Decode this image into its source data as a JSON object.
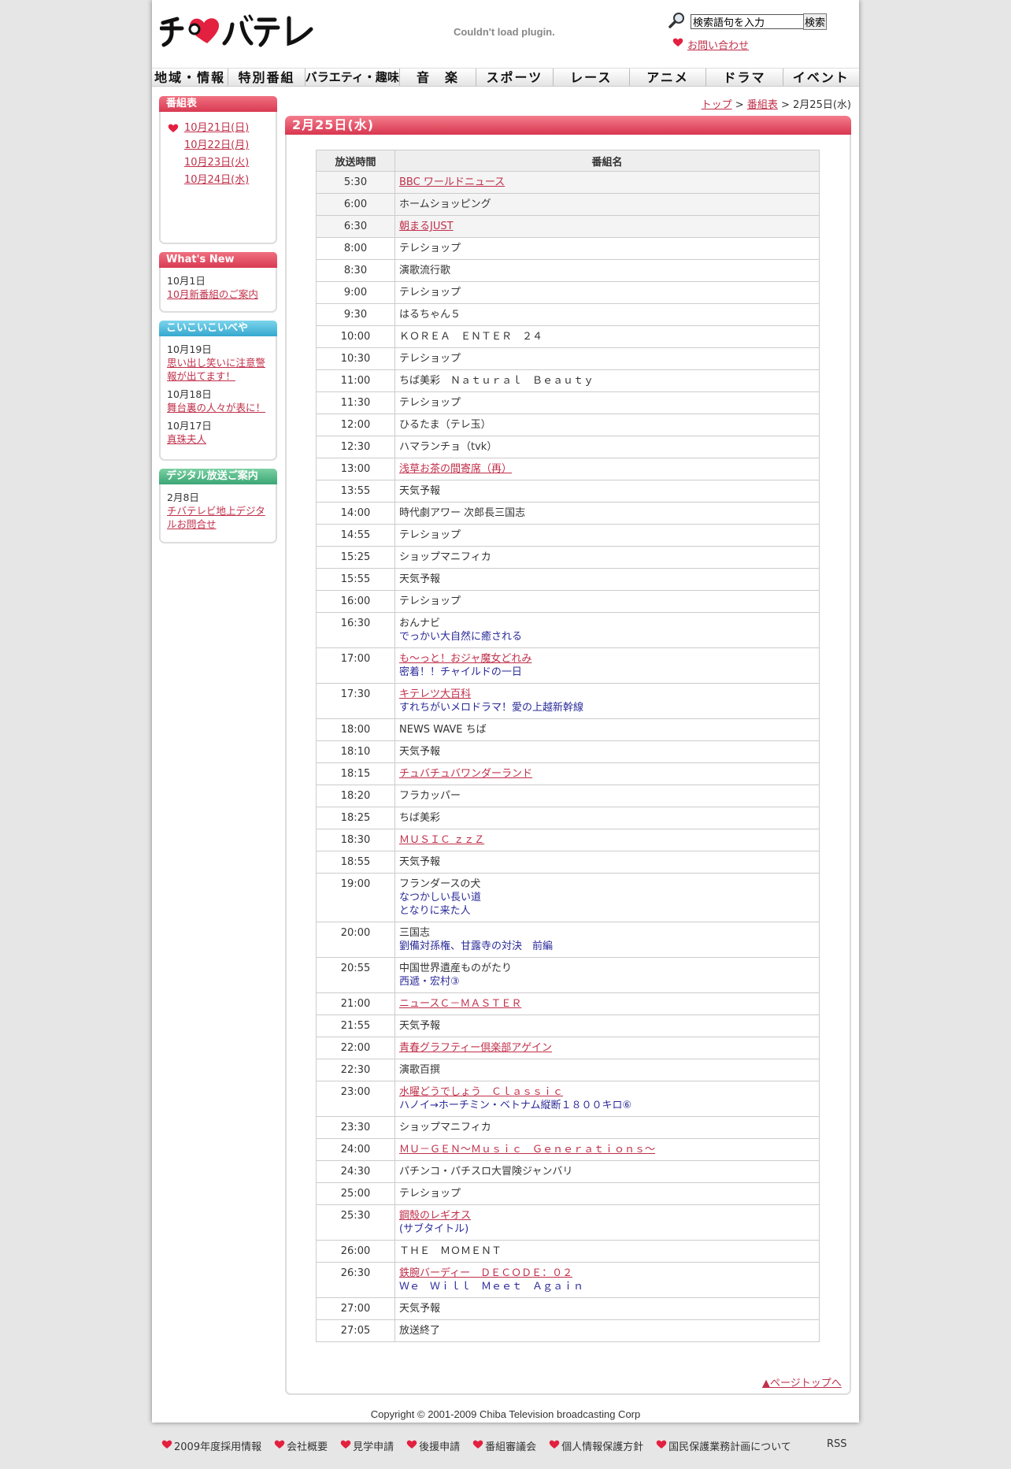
{
  "header": {
    "logo_text": "チバテレ",
    "plugin_msg": "Couldn't load plugin.",
    "search_placeholder": "検索語句を入力",
    "search_btn": "検索",
    "contact": "お問い合わせ"
  },
  "nav": [
    "地域・情報",
    "特別番組",
    "バラエティ・趣味",
    "音　楽",
    "スポーツ",
    "レース",
    "アニメ",
    "ドラマ",
    "イベント"
  ],
  "sidebar": {
    "schedule": {
      "title": "番組表",
      "dates": [
        "10月21日(日)",
        "10月22日(月)",
        "10月23日(火)",
        "10月24日(水)"
      ]
    },
    "whats_new": {
      "title": "What's New",
      "entries": [
        {
          "date": "10月1日",
          "link": "10月新番組のご案内"
        }
      ]
    },
    "koikoi": {
      "title": "こいこいこいべや",
      "entries": [
        {
          "date": "10月19日",
          "link": "思い出し笑いに注意警報が出てます！"
        },
        {
          "date": "10月18日",
          "link": "舞台裏の人々が表に！"
        },
        {
          "date": "10月17日",
          "link": "真珠夫人"
        }
      ]
    },
    "digital": {
      "title": "デジタル放送ご案内",
      "entries": [
        {
          "date": "2月8日",
          "link": "チバテレビ地上デジタルお問合せ"
        }
      ]
    }
  },
  "breadcrumb": {
    "top": "トップ",
    "sep1": ">",
    "schedule": "番組表",
    "sep2": ">",
    "current": "2月25日(水)"
  },
  "main": {
    "title": "2月25日(水)",
    "col_time": "放送時間",
    "col_name": "番組名",
    "pagetop": "▲ページトップへ"
  },
  "schedule": [
    {
      "time": "5:30",
      "title": "BBC ワールドニュース",
      "link": true
    },
    {
      "time": "6:00",
      "title": "ホームショッピング",
      "link": false
    },
    {
      "time": "6:30",
      "title": "朝まるJUST",
      "link": true
    },
    {
      "time": "8:00",
      "title": "テレショップ",
      "link": false
    },
    {
      "time": "8:30",
      "title": "演歌流行歌",
      "link": false
    },
    {
      "time": "9:00",
      "title": "テレショップ",
      "link": false
    },
    {
      "time": "9:30",
      "title": "はるちゃん５",
      "link": false
    },
    {
      "time": "10:00",
      "title": "ＫＯＲＥＡ　ＥＮＴＥＲ　２４",
      "link": false
    },
    {
      "time": "10:30",
      "title": "テレショップ",
      "link": false
    },
    {
      "time": "11:00",
      "title": "ちば美彩　Ｎａｔｕｒａｌ　Ｂｅａｕｔｙ",
      "link": false
    },
    {
      "time": "11:30",
      "title": "テレショップ",
      "link": false
    },
    {
      "time": "12:00",
      "title": "ひるたま（テレ玉）",
      "link": false
    },
    {
      "time": "12:30",
      "title": "ハマランチョ（tvk）",
      "link": false
    },
    {
      "time": "13:00",
      "title": "浅草お茶の間寄席（再）",
      "link": true
    },
    {
      "time": "13:55",
      "title": "天気予報",
      "link": false
    },
    {
      "time": "14:00",
      "title": "時代劇アワー 次郎長三国志",
      "link": false
    },
    {
      "time": "14:55",
      "title": "テレショップ",
      "link": false
    },
    {
      "time": "15:25",
      "title": "ショップマニフィカ",
      "link": false
    },
    {
      "time": "15:55",
      "title": "天気予報",
      "link": false
    },
    {
      "time": "16:00",
      "title": "テレショップ",
      "link": false
    },
    {
      "time": "16:30",
      "title": "おんナビ",
      "link": false,
      "subs": [
        "でっかい大自然に癒される"
      ]
    },
    {
      "time": "17:00",
      "title": "も～っと！おジャ魔女どれみ",
      "link": true,
      "subs": [
        "密着！！チャイルドの一日"
      ]
    },
    {
      "time": "17:30",
      "title": "キテレツ大百科",
      "link": true,
      "subs": [
        "すれちがいメロドラマ！愛の上越新幹線"
      ]
    },
    {
      "time": "18:00",
      "title": "NEWS WAVE ちば",
      "link": false
    },
    {
      "time": "18:10",
      "title": "天気予報",
      "link": false
    },
    {
      "time": "18:15",
      "title": "チュバチュバワンダーランド",
      "link": true
    },
    {
      "time": "18:20",
      "title": "フラカッパー",
      "link": false
    },
    {
      "time": "18:25",
      "title": "ちば美彩",
      "link": false
    },
    {
      "time": "18:30",
      "title": "ＭＵＳＩＣ ｚｚＺ",
      "link": true
    },
    {
      "time": "18:55",
      "title": "天気予報",
      "link": false
    },
    {
      "time": "19:00",
      "title": "フランダースの犬",
      "link": false,
      "subs": [
        "なつかしい長い道",
        "となりに来た人"
      ]
    },
    {
      "time": "20:00",
      "title": "三国志",
      "link": false,
      "subs": [
        "劉備対孫権、甘露寺の対決　前編"
      ]
    },
    {
      "time": "20:55",
      "title": "中国世界遺産ものがたり",
      "link": false,
      "subs": [
        "西遞・宏村③"
      ]
    },
    {
      "time": "21:00",
      "title": "ニュースＣ－ＭＡＳＴＥＲ",
      "link": true
    },
    {
      "time": "21:55",
      "title": "天気予報",
      "link": false
    },
    {
      "time": "22:00",
      "title": "青春グラフティー倶楽部アゲイン",
      "link": true
    },
    {
      "time": "22:30",
      "title": "演歌百撰",
      "link": false
    },
    {
      "time": "23:00",
      "title": "水曜どうでしょう　Ｃｌａｓｓｉｃ",
      "link": true,
      "subs": [
        "ハノイ→ホーチミン・ベトナム縦断１８００キロ⑥"
      ]
    },
    {
      "time": "23:30",
      "title": "ショップマニフィカ",
      "link": false
    },
    {
      "time": "24:00",
      "title": "ＭＵ－ＧＥＮ～Ｍｕｓｉｃ　Ｇｅｎｅｒａｔｉｏｎｓ～",
      "link": true
    },
    {
      "time": "24:30",
      "title": "パチンコ・パチスロ大冒険ジャンバリ",
      "link": false
    },
    {
      "time": "25:00",
      "title": "テレショップ",
      "link": false
    },
    {
      "time": "25:30",
      "title": "鋼殻のレギオス",
      "link": true,
      "subs": [
        "(サブタイトル)"
      ]
    },
    {
      "time": "26:00",
      "title": "ＴＨＥ　ＭＯＭＥＮＴ",
      "link": false
    },
    {
      "time": "26:30",
      "title": "鉄腕バーディー　ＤＥＣＯＤＥ：０２",
      "link": true,
      "subs": [
        "Ｗｅ　Ｗｉｌｌ　Ｍｅｅｔ　Ａｇａｉｎ"
      ]
    },
    {
      "time": "27:00",
      "title": "天気予報",
      "link": false
    },
    {
      "time": "27:05",
      "title": "放送終了",
      "link": false
    }
  ],
  "footer": {
    "copyright": "Copyright © 2001-2009 Chiba Television broadcasting Corp",
    "links": [
      "2009年度採用情報",
      "会社概要",
      "見学申請",
      "後援申請",
      "番組審議会",
      "個人情報保護方針",
      "国民保護業務計画について"
    ],
    "rss": "RSS"
  },
  "colors": {
    "accent": "#d93a53",
    "link": "#c0304a",
    "subtitle": "#2b2b9a"
  }
}
